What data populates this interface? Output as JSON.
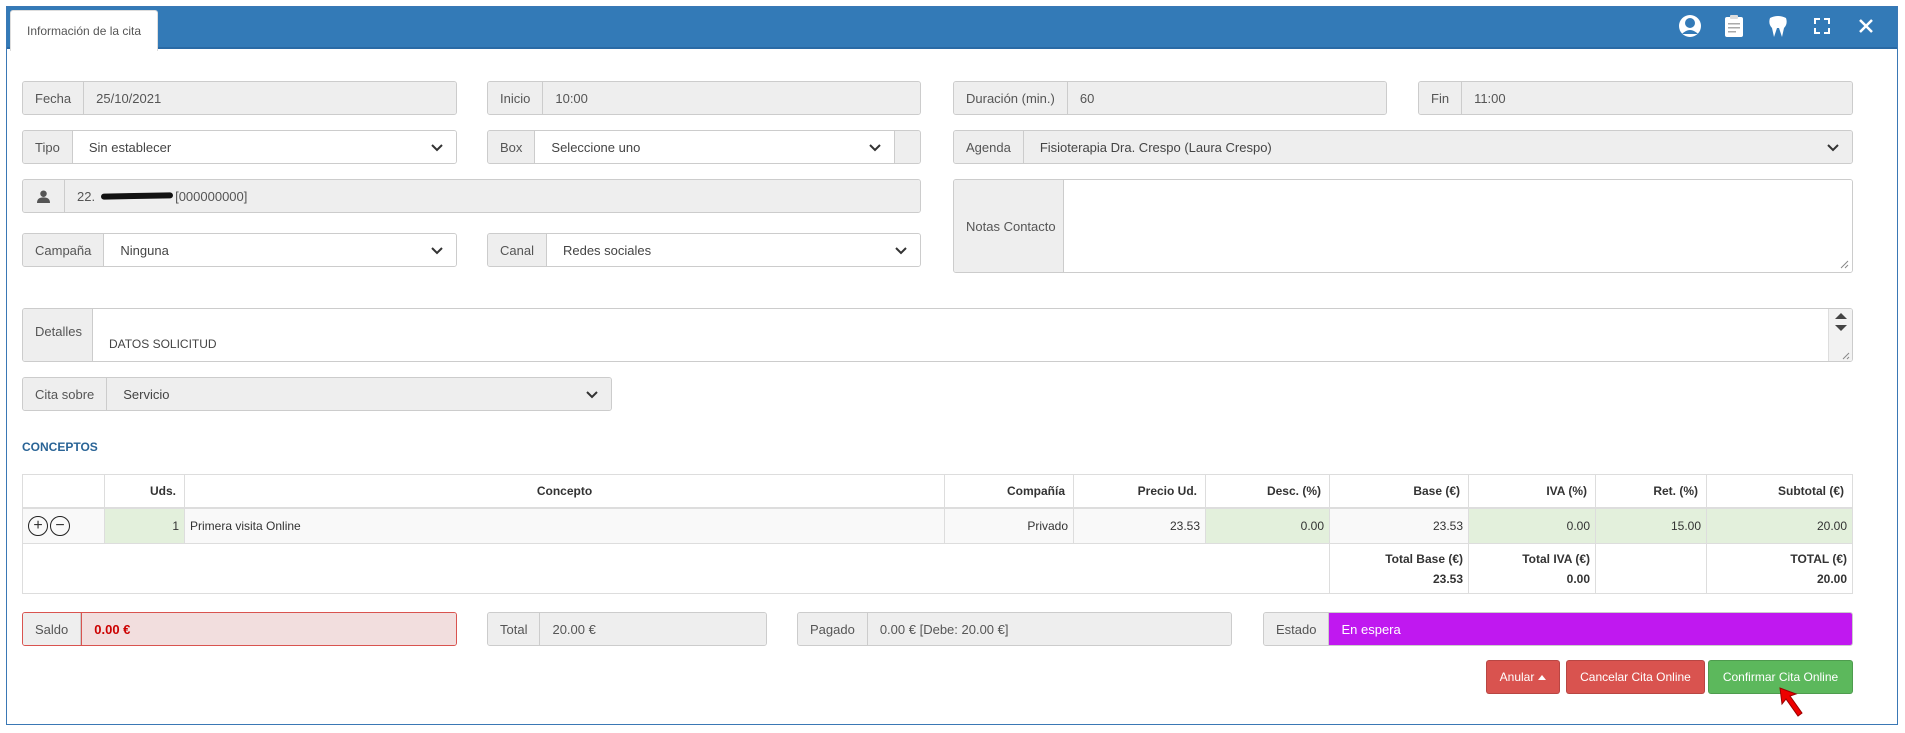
{
  "header": {
    "tab_label": "Información de la cita",
    "icons": [
      "user-circle-icon",
      "clipboard-icon",
      "tooth-icon",
      "expand-icon",
      "close-icon"
    ]
  },
  "form": {
    "fecha": {
      "label": "Fecha",
      "value": "25/10/2021"
    },
    "inicio": {
      "label": "Inicio",
      "value": "10:00"
    },
    "duracion": {
      "label": "Duración (min.)",
      "value": "60"
    },
    "fin": {
      "label": "Fin",
      "value": "11:00"
    },
    "tipo": {
      "label": "Tipo",
      "value": "Sin establecer"
    },
    "box": {
      "label": "Box",
      "value": "Seleccione uno"
    },
    "agenda": {
      "label": "Agenda",
      "value": "Fisioterapia Dra. Crespo (Laura Crespo)"
    },
    "patient": {
      "prefix": "22.",
      "suffix": "[000000000]"
    },
    "notas": {
      "label": "Notas Contacto",
      "value": ""
    },
    "campana": {
      "label": "Campaña",
      "value": "Ninguna"
    },
    "canal": {
      "label": "Canal",
      "value": "Redes sociales"
    },
    "detalles": {
      "label": "Detalles",
      "line1": "DATOS SOLICITUD"
    },
    "cita_sobre": {
      "label": "Cita sobre",
      "value": "Servicio"
    }
  },
  "conceptos": {
    "title": "CONCEPTOS",
    "headers": [
      "Uds.",
      "Concepto",
      "Compañía",
      "Precio Ud.",
      "Desc. (%)",
      "Base (€)",
      "IVA (%)",
      "Ret. (%)",
      "Subtotal (€)"
    ],
    "row": {
      "uds": "1",
      "concepto": "Primera visita Online",
      "compania": "Privado",
      "precio": "23.53",
      "desc": "0.00",
      "base": "23.53",
      "iva": "0.00",
      "ret": "15.00",
      "subtotal": "20.00"
    },
    "totals": {
      "base_label": "Total Base (€)",
      "base_value": "23.53",
      "iva_label": "Total IVA (€)",
      "iva_value": "0.00",
      "total_label": "TOTAL (€)",
      "total_value": "20.00"
    }
  },
  "summary": {
    "saldo": {
      "label": "Saldo",
      "value": "0.00 €"
    },
    "total": {
      "label": "Total",
      "value": "20.00 €"
    },
    "pagado": {
      "label": "Pagado",
      "value": "0.00 € [Debe: 20.00 €]"
    },
    "estado": {
      "label": "Estado",
      "value": "En espera",
      "color": "#c018f0"
    }
  },
  "actions": {
    "anular": "Anular",
    "cancelar": "Cancelar Cita Online",
    "confirmar": "Confirmar Cita Online"
  },
  "colors": {
    "header": "#337ab7",
    "danger": "#d9534f",
    "success": "#5cb85c",
    "accent_title": "#2a6496"
  }
}
